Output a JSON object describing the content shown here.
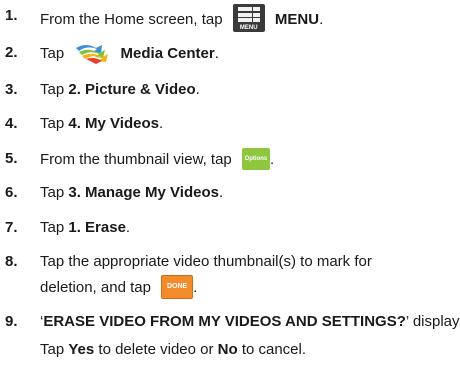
{
  "steps": [
    {
      "num": "1.",
      "pre": "From the Home screen, tap",
      "post": "MENU",
      "after": "."
    },
    {
      "num": "2.",
      "pre": "Tap",
      "post": "Media Center",
      "after": "."
    },
    {
      "num": "3.",
      "pre": "Tap ",
      "bold": "2. Picture & Video",
      "after": "."
    },
    {
      "num": "4.",
      "pre": "Tap ",
      "bold": "4. My Videos",
      "after": "."
    },
    {
      "num": "5.",
      "pre": "From the thumbnail view, tap",
      "after": "."
    },
    {
      "num": "6.",
      "pre": "Tap ",
      "bold": "3. Manage My Videos",
      "after": "."
    },
    {
      "num": "7.",
      "pre": "Tap ",
      "bold": "1. Erase",
      "after": "."
    },
    {
      "num": "8.",
      "line1": "Tap the appropriate video thumbnail(s) to mark for",
      "line2": "deletion, and tap",
      "after": "."
    },
    {
      "num": "9.",
      "quote_open": "‘",
      "bold": "ERASE VIDEO FROM MY VIDEOS AND SETTINGS?",
      "quote_close": "’ displays.",
      "line2_pre": "Tap ",
      "yes": "Yes",
      "line2_mid": " to delete video or ",
      "no": "No",
      "line2_post": " to cancel."
    }
  ],
  "icons": {
    "menu": {
      "name": "menu-grid-icon",
      "caption": "MENU",
      "color": "#3a3a3a"
    },
    "media": {
      "name": "media-center-icon"
    },
    "options": {
      "name": "options-button-icon",
      "label": "Options",
      "color": "#8ec640"
    },
    "done": {
      "name": "done-button-icon",
      "label": "DONE",
      "color": "#f28b2c"
    }
  }
}
